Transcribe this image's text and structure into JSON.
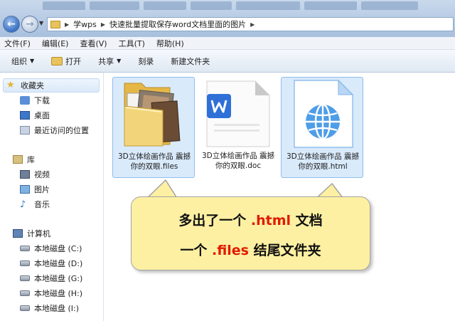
{
  "address": {
    "crumbs": [
      "学wps",
      "快速批量提取保存word文档里面的图片"
    ]
  },
  "menu": [
    "文件(F)",
    "编辑(E)",
    "查看(V)",
    "工具(T)",
    "帮助(H)"
  ],
  "toolbar": {
    "organize": "组织",
    "open": "打开",
    "share": "共享",
    "burn": "刻录",
    "new_folder": "新建文件夹"
  },
  "sidebar": {
    "favorites": "收藏夹",
    "downloads": "下载",
    "desktop": "桌面",
    "recent": "最近访问的位置",
    "libraries": "库",
    "videos": "视频",
    "pictures": "图片",
    "music": "音乐",
    "computer": "计算机",
    "drives": [
      "本地磁盘 (C:)",
      "本地磁盘 (D:)",
      "本地磁盘 (G:)",
      "本地磁盘 (H:)",
      "本地磁盘 (I:)"
    ]
  },
  "files": [
    {
      "line1": "3D立体绘画作品 震撼",
      "line2": "你的双眼.files",
      "icon": "folder-with-photos-icon",
      "selected": true
    },
    {
      "line1": "3D立体绘画作品 震撼",
      "line2": "你的双眼.doc",
      "icon": "wps-word-document-icon",
      "selected": false
    },
    {
      "line1": "3D立体绘画作品 震撼",
      "line2": "你的双眼.html",
      "icon": "html-globe-document-icon",
      "selected": true
    }
  ],
  "callout": {
    "l1_prefix": "多出了一个 ",
    "l1_highlight": ".html",
    "l1_suffix": " 文档",
    "l2_prefix": "一个 ",
    "l2_highlight": ".files",
    "l2_suffix": " 结尾文件夹"
  },
  "colors": {
    "highlight": "#e21b00",
    "callout_bg": "#fdf0a2",
    "selection": "#d9eafb"
  }
}
